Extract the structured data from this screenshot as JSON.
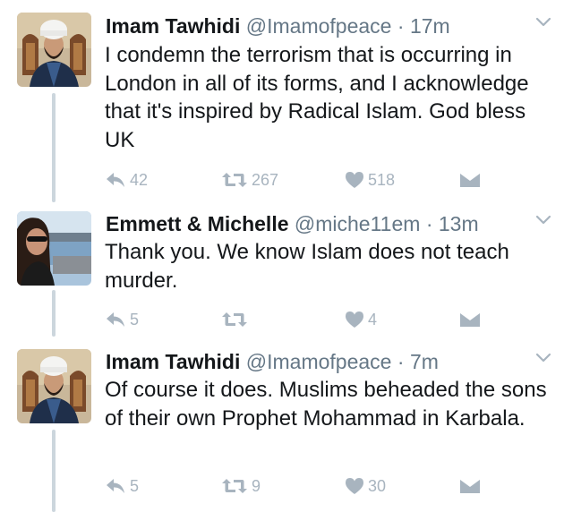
{
  "colors": {
    "text": "#14171a",
    "muted": "#657786",
    "icon": "#a8b4bf",
    "connector": "#ccd6dd"
  },
  "tweets": [
    {
      "name": "Imam Tawhidi",
      "handle": "@Imamofpeace",
      "dot": "·",
      "time": "17m",
      "text": "I condemn the terrorism that is occurring in London in all of its forms, and I acknowledge that it's inspired by Radical Islam. God bless UK",
      "replies": "42",
      "retweets": "267",
      "likes": "518",
      "avatar": "cleric-white-turban"
    },
    {
      "name": "Emmett & Michelle",
      "handle": "@miche11em",
      "dot": "·",
      "time": "13m",
      "text": "Thank you. We know Islam does not teach murder.",
      "replies": "5",
      "retweets": "",
      "likes": "4",
      "avatar": "woman-sunglasses-waterfront"
    },
    {
      "name": "Imam Tawhidi",
      "handle": "@Imamofpeace",
      "dot": "·",
      "time": "7m",
      "text": "Of course it does. Muslims beheaded the sons of their own Prophet Mohammad in Karbala.",
      "replies": "5",
      "retweets": "9",
      "likes": "30",
      "avatar": "cleric-white-turban"
    }
  ],
  "icons": {
    "reply": "reply-icon",
    "retweet": "retweet-icon",
    "like": "heart-icon",
    "dm": "direct-message-icon",
    "more": "chevron-down-icon"
  }
}
